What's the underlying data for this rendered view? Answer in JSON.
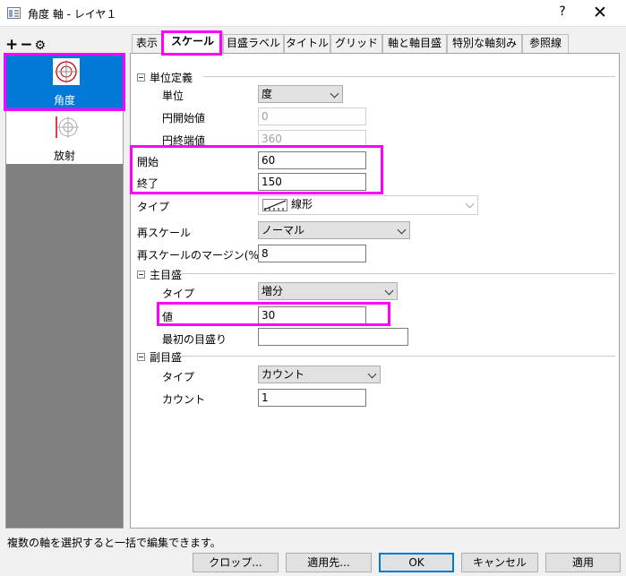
{
  "window": {
    "title": "角度 軸 - レイヤ１",
    "help": "?",
    "close": "✕"
  },
  "toolbar": {
    "add": "+",
    "remove": "−",
    "settings": "⚙"
  },
  "sidebar": {
    "items": [
      {
        "label": "角度"
      },
      {
        "label": "放射"
      }
    ]
  },
  "tabs": [
    "表示",
    "スケール",
    "目盛ラベル",
    "タイトル",
    "グリッド線",
    "軸と軸目盛",
    "特別な軸刻み",
    "参照線"
  ],
  "scale": {
    "unit_section": "単位定義",
    "unit_label": "単位",
    "unit_value": "度",
    "circle_start_label": "円開始値",
    "circle_start_value": "0",
    "circle_end_label": "円終端値",
    "circle_end_value": "360",
    "from_label": "開始",
    "from_value": "60",
    "to_label": "終了",
    "to_value": "150",
    "type_label": "タイプ",
    "type_value": "線形",
    "rescale_label": "再スケール",
    "rescale_value": "ノーマル",
    "margin_label": "再スケールのマージン(%)",
    "margin_value": "8",
    "major_section": "主目盛",
    "major_type_label": "タイプ",
    "major_type_value": "増分",
    "major_value_label": "値",
    "major_value_value": "30",
    "first_tick_label": "最初の目盛り",
    "first_tick_value": "",
    "minor_section": "副目盛",
    "minor_type_label": "タイプ",
    "minor_type_value": "カウント",
    "minor_count_label": "カウント",
    "minor_count_value": "1"
  },
  "status": "複数の軸を選択すると一括で編集できます。",
  "buttons": {
    "crop": "クロップ...",
    "apply_to": "適用先...",
    "ok": "OK",
    "cancel": "キャンセル",
    "apply": "適用"
  },
  "colors": {
    "accent": "#0078d7",
    "highlight": "#ff00ff",
    "sidebar_bg": "#808080"
  }
}
